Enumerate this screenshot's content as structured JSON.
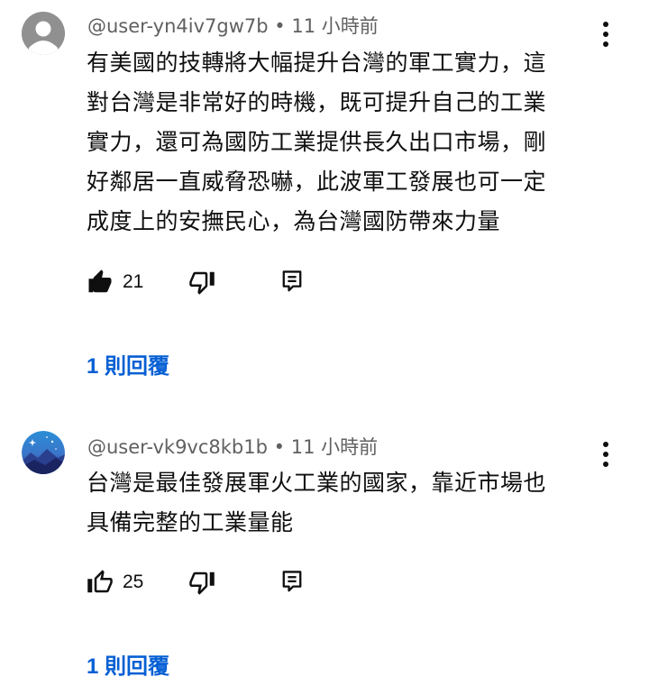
{
  "comments": [
    {
      "author": "@user-yn4iv7gw7b",
      "separator": "•",
      "time": "11 小時前",
      "lines": [
        "有美國的技轉將大幅提升台灣的軍工實力，這",
        "對台灣是非常好的時機，既可提升自己的工業",
        "實力，還可為國防工業提供長久出口市場，剛",
        "好鄰居一直威脅恐嚇，此波軍工發展也可一定",
        "成度上的安撫民心，為台灣國防帶來力量"
      ],
      "likes": "21",
      "liked": true,
      "replies_label": "1 則回覆",
      "avatar": "default-person-avatar"
    },
    {
      "author": "@user-vk9vc8kb1b",
      "separator": "•",
      "time": "11 小時前",
      "lines": [
        "台灣是最佳發展軍火工業的國家，靠近市場也",
        "具備完整的工業量能"
      ],
      "likes": "25",
      "liked": false,
      "replies_label": "1 則回覆",
      "avatar": "night-sky-avatar"
    }
  ],
  "icons": {
    "like": "thumbs-up-icon",
    "dislike": "thumbs-down-icon",
    "reply": "reply-icon",
    "menu": "more-vert-icon"
  },
  "colors": {
    "link": "#065fd4",
    "meta": "#606060",
    "text": "#0f0f0f",
    "avatar_default_bg": "#909090"
  }
}
